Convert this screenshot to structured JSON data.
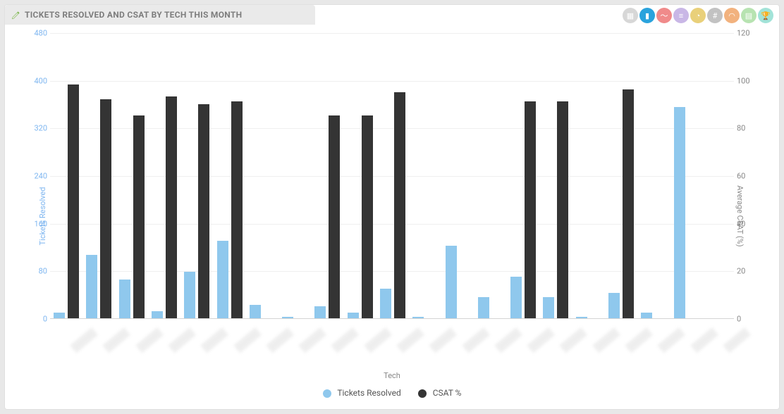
{
  "header": {
    "title": "TICKETS RESOLVED AND CSAT BY TECH THIS MONTH",
    "toolbar_icons": [
      {
        "name": "table-icon",
        "color": "gray",
        "glyph": "▦"
      },
      {
        "name": "bar-chart-icon",
        "color": "blue",
        "glyph": "▮"
      },
      {
        "name": "line-chart-icon",
        "color": "red",
        "glyph": "〜"
      },
      {
        "name": "stacked-bar-icon",
        "color": "purple",
        "glyph": "≡"
      },
      {
        "name": "pie-chart-icon",
        "color": "gold",
        "glyph": "◔"
      },
      {
        "name": "number-icon",
        "color": "darkgray",
        "glyph": "#"
      },
      {
        "name": "gauge-icon",
        "color": "orange",
        "glyph": "◠"
      },
      {
        "name": "list-icon",
        "color": "green",
        "glyph": "▤"
      },
      {
        "name": "trophy-icon",
        "color": "teal",
        "glyph": "🏆"
      }
    ]
  },
  "colors": {
    "tickets": "#8fc8ed",
    "csat": "#343434",
    "left_axis": "#7eb6f0",
    "right_axis": "#888888"
  },
  "chart_data": {
    "type": "bar",
    "title": "TICKETS RESOLVED AND CSAT BY TECH THIS MONTH",
    "xlabel": "Tech",
    "y_left": {
      "label": "Tickets Resolved",
      "lim": [
        0,
        480
      ],
      "ticks": [
        0,
        80,
        160,
        240,
        320,
        400,
        480
      ]
    },
    "y_right": {
      "label": "Average CSAT (%)",
      "lim": [
        0,
        120
      ],
      "ticks": [
        0,
        20,
        40,
        60,
        80,
        100,
        120
      ]
    },
    "categories": [
      "Tech 1",
      "Tech 2",
      "Tech 3",
      "Tech 4",
      "Tech 5",
      "Tech 6",
      "Tech 7",
      "Tech 8",
      "Tech 9",
      "Tech 10",
      "Tech 11",
      "Tech 12",
      "Tech 13",
      "Tech 14",
      "Tech 15",
      "Tech 16",
      "Tech 17",
      "Tech 18",
      "Tech 19",
      "Tech 20",
      "Tech 21"
    ],
    "categories_redacted": true,
    "series": [
      {
        "name": "Tickets Resolved",
        "axis": "left",
        "color": "#8fc8ed",
        "values": [
          10,
          106,
          65,
          12,
          78,
          130,
          22,
          2,
          20,
          10,
          50,
          2,
          122,
          35,
          70,
          35,
          2,
          42,
          10,
          355,
          null
        ]
      },
      {
        "name": "CSAT %",
        "axis": "right",
        "color": "#343434",
        "values": [
          98,
          92,
          85,
          93,
          90,
          91,
          null,
          null,
          85,
          85,
          95,
          null,
          null,
          null,
          91,
          91,
          null,
          96,
          null,
          null,
          null
        ]
      }
    ],
    "legend_labels": [
      "Tickets Resolved",
      "CSAT %"
    ]
  }
}
